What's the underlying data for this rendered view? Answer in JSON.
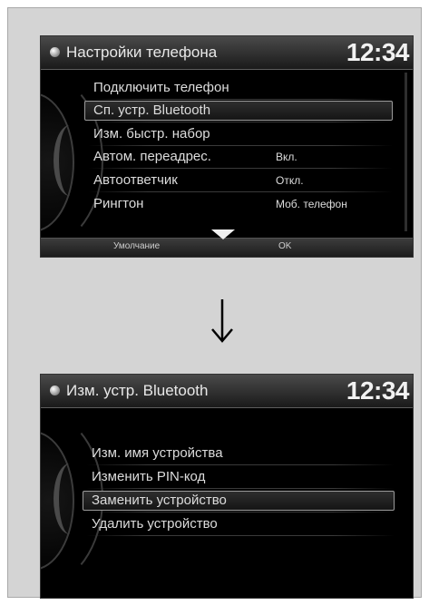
{
  "screen1": {
    "title": "Настройки телефона",
    "clock": "12:34",
    "items": [
      {
        "label": "Подключить телефон",
        "value": ""
      },
      {
        "label": "Сп. устр. Bluetooth",
        "value": ""
      },
      {
        "label": "Изм. быстр. набор",
        "value": ""
      },
      {
        "label": "Автом. переадрес.",
        "value": "Вкл."
      },
      {
        "label": "Автоответчик",
        "value": "Откл."
      },
      {
        "label": "Рингтон",
        "value": "Моб. телефон"
      }
    ],
    "bottom_left": "Умолчание",
    "bottom_right": "OK"
  },
  "screen2": {
    "title": "Изм. устр. Bluetooth",
    "clock": "12:34",
    "items": [
      {
        "label": "Изм. имя устройства"
      },
      {
        "label": "Изменить PIN-код"
      },
      {
        "label": "Заменить устройство"
      },
      {
        "label": "Удалить устройство"
      }
    ]
  },
  "icons": {
    "title_bullet": "round-bullet-icon",
    "transition_arrow": "down-arrow-icon",
    "scroll_down": "chevron-down-icon"
  },
  "colors": {
    "page_bg": "#d4d4d4",
    "screen_bg": "#000000",
    "text": "#dcdcdc",
    "highlight_border": "#9b9b9b"
  }
}
